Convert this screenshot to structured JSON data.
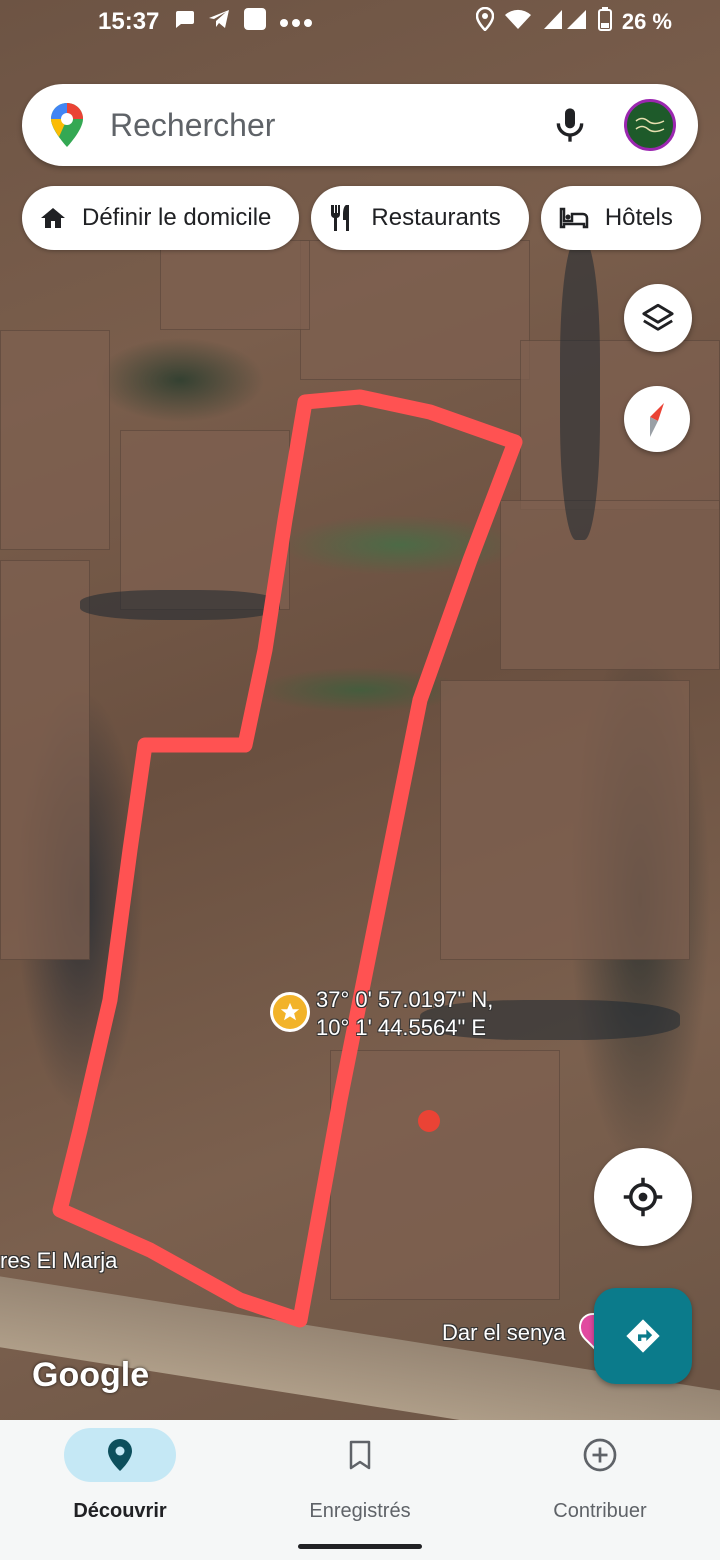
{
  "status_bar": {
    "time": "15:37",
    "battery": "26 %",
    "icons": [
      "chat-bubble-icon",
      "telegram-icon",
      "app-square-icon",
      "more-dots-icon",
      "location-icon",
      "wifi-icon",
      "signal-icon",
      "battery-icon"
    ]
  },
  "search": {
    "placeholder": "Rechercher",
    "icons": [
      "maps-pin-icon",
      "mic-icon",
      "account-avatar"
    ]
  },
  "chips": [
    {
      "label": "Définir le domicile",
      "icon": "home-icon"
    },
    {
      "label": "Restaurants",
      "icon": "fork-knife-icon"
    },
    {
      "label": "Hôtels",
      "icon": "bed-icon"
    }
  ],
  "map": {
    "coordinates_line1": "37° 0' 57.0197\" N,",
    "coordinates_line2": "10° 1' 44.5564\" E",
    "label_left": "res El Marja",
    "label_poi": "Dar el senya",
    "attribution": "Google"
  },
  "bottom_nav": {
    "items": [
      {
        "label": "Découvrir",
        "icon": "location-pin-icon",
        "active": true
      },
      {
        "label": "Enregistrés",
        "icon": "bookmark-icon",
        "active": false
      },
      {
        "label": "Contribuer",
        "icon": "add-circle-icon",
        "active": false
      }
    ]
  },
  "colors": {
    "accent": "#0b7b8b",
    "nav_active": "#c5e8f5",
    "outline_red": "#ff5252"
  }
}
